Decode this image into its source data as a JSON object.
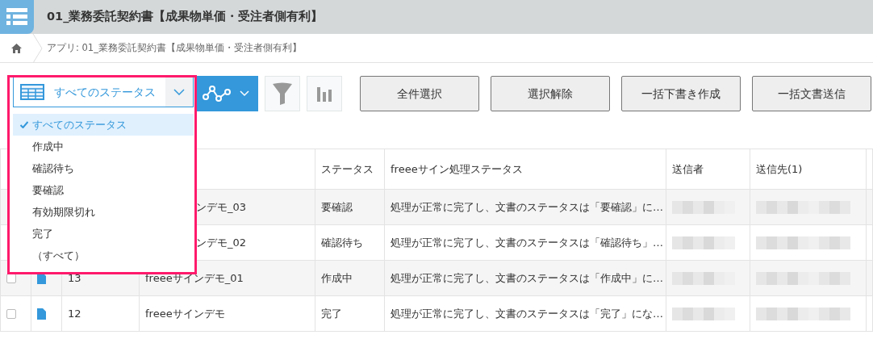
{
  "header": {
    "title": "01_業務委託契約書【成果物単価・受注者側有利】"
  },
  "breadcrumb": {
    "text": "アプリ: 01_業務委託契約書【成果物単価・受注者側有利】"
  },
  "view_select": {
    "label": "すべてのステータス",
    "expanded": true,
    "options": [
      {
        "label": "すべてのステータス",
        "selected": true
      },
      {
        "label": "作成中",
        "selected": false
      },
      {
        "label": "確認待ち",
        "selected": false
      },
      {
        "label": "要確認",
        "selected": false
      },
      {
        "label": "有効期限切れ",
        "selected": false
      },
      {
        "label": "完了",
        "selected": false
      },
      {
        "label": "（すべて）",
        "selected": false
      }
    ]
  },
  "buttons": [
    "全件選択",
    "選択解除",
    "一括下書き作成",
    "一括文書送信"
  ],
  "table": {
    "columns": [
      "ステータス",
      "freeeサイン処理ステータス",
      "送信者",
      "送信先(1)"
    ],
    "rows": [
      {
        "name": "ンデモ_03",
        "status": "要確認",
        "process_status": "処理が正常に完了し、文書のステータスは「要確認」に…"
      },
      {
        "name": "ンデモ_02",
        "status": "確認待ち",
        "process_status": "処理が正常に完了し、文書のステータスは「確認待ち」…"
      },
      {
        "checked": false,
        "number": "13",
        "name": "freeeサインデモ_01",
        "status": "作成中",
        "process_status": "処理が正常に完了し、文書のステータスは「作成中」に…"
      },
      {
        "checked": false,
        "number": "12",
        "name": "freeeサインデモ",
        "status": "完了",
        "process_status": "処理が正常に完了し、文書のステータスは「完了」にな…"
      }
    ]
  }
}
